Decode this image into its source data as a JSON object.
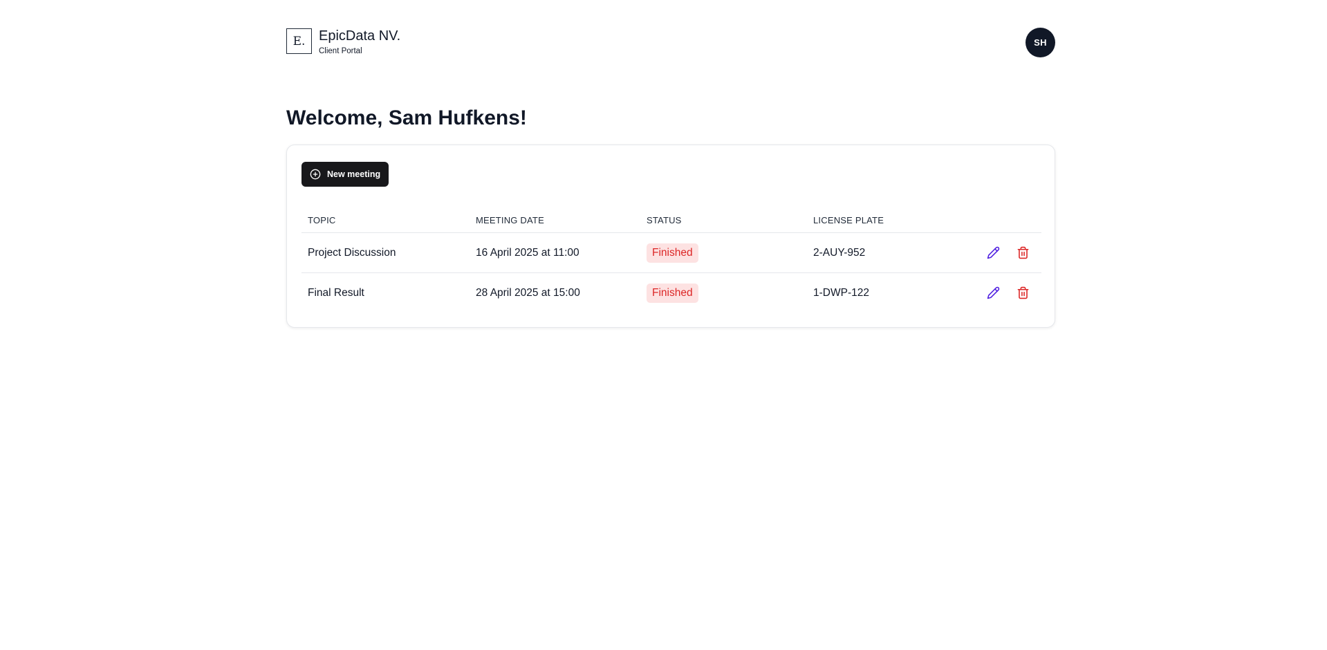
{
  "header": {
    "logo_letter": "E.",
    "company_name": "EpicData NV.",
    "portal_name": "Client Portal",
    "avatar_initials": "SH"
  },
  "welcome": "Welcome, Sam Hufkens!",
  "toolbar": {
    "new_meeting_label": "New meeting"
  },
  "table": {
    "columns": [
      "TOPIC",
      "MEETING DATE",
      "STATUS",
      "LICENSE PLATE"
    ],
    "rows": [
      {
        "topic": "Project Discussion",
        "meeting_date": "16 April 2025 at 11:00",
        "status": "Finished",
        "license_plate": "2-AUY-952"
      },
      {
        "topic": "Final Result",
        "meeting_date": "28 April 2025 at 15:00",
        "status": "Finished",
        "license_plate": "1-DWP-122"
      }
    ]
  },
  "icons": {
    "new_meeting": "plus-circle-icon",
    "edit": "pencil-icon",
    "delete": "trash-icon"
  },
  "colors": {
    "primary_dark": "#18181b",
    "status_finished_bg": "#fde2e2",
    "status_finished_text": "#dc2626",
    "edit_icon": "#4f1ee0",
    "delete_icon": "#dc2626"
  }
}
